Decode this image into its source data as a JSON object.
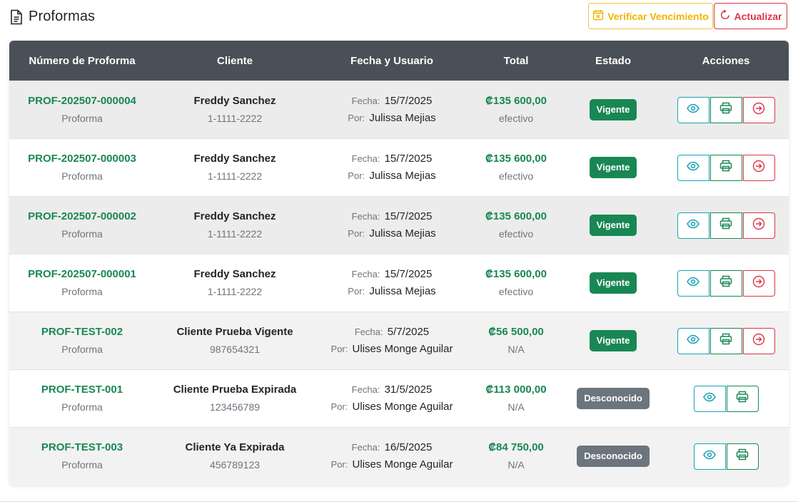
{
  "header": {
    "title": "Proformas",
    "verify_label": "Verificar Vencimiento",
    "refresh_label": "Actualizar"
  },
  "colors": {
    "header_bg": "#495057",
    "green": "#198754",
    "warning": "#f0b400",
    "danger": "#dc3545",
    "info": "#17a2b8",
    "muted": "#6c757d"
  },
  "icons": {
    "title": "document-icon",
    "verify": "calendar-x-icon",
    "refresh": "refresh-icon",
    "view": "eye-icon",
    "print": "printer-icon",
    "send": "arrow-right-circle-icon"
  },
  "table": {
    "columns": [
      "Número de Proforma",
      "Cliente",
      "Fecha y Usuario",
      "Total",
      "Estado",
      "Acciones"
    ],
    "fecha_label": "Fecha:",
    "por_label": "Por:",
    "rows": [
      {
        "number": "PROF-202507-000004",
        "type": "Proforma",
        "client": "Freddy Sanchez",
        "id": "1-1111-2222",
        "date": "15/7/2025",
        "user": "Julissa Mejias",
        "total": "₡135 600,00",
        "method": "efectivo",
        "status": "Vigente",
        "status_kind": "green",
        "has_send": true
      },
      {
        "number": "PROF-202507-000003",
        "type": "Proforma",
        "client": "Freddy Sanchez",
        "id": "1-1111-2222",
        "date": "15/7/2025",
        "user": "Julissa Mejias",
        "total": "₡135 600,00",
        "method": "efectivo",
        "status": "Vigente",
        "status_kind": "green",
        "has_send": true
      },
      {
        "number": "PROF-202507-000002",
        "type": "Proforma",
        "client": "Freddy Sanchez",
        "id": "1-1111-2222",
        "date": "15/7/2025",
        "user": "Julissa Mejias",
        "total": "₡135 600,00",
        "method": "efectivo",
        "status": "Vigente",
        "status_kind": "green",
        "has_send": true
      },
      {
        "number": "PROF-202507-000001",
        "type": "Proforma",
        "client": "Freddy Sanchez",
        "id": "1-1111-2222",
        "date": "15/7/2025",
        "user": "Julissa Mejias",
        "total": "₡135 600,00",
        "method": "efectivo",
        "status": "Vigente",
        "status_kind": "green",
        "has_send": true
      },
      {
        "number": "PROF-TEST-002",
        "type": "Proforma",
        "client": "Cliente Prueba Vigente",
        "id": "987654321",
        "date": "5/7/2025",
        "user": "Ulises Monge Aguilar",
        "total": "₡56 500,00",
        "method": "N/A",
        "status": "Vigente",
        "status_kind": "green",
        "has_send": true
      },
      {
        "number": "PROF-TEST-001",
        "type": "Proforma",
        "client": "Cliente Prueba Expirada",
        "id": "123456789",
        "date": "31/5/2025",
        "user": "Ulises Monge Aguilar",
        "total": "₡113 000,00",
        "method": "N/A",
        "status": "Desconocido",
        "status_kind": "gray",
        "has_send": false
      },
      {
        "number": "PROF-TEST-003",
        "type": "Proforma",
        "client": "Cliente Ya Expirada",
        "id": "456789123",
        "date": "16/5/2025",
        "user": "Ulises Monge Aguilar",
        "total": "₡84 750,00",
        "method": "N/A",
        "status": "Desconocido",
        "status_kind": "gray",
        "has_send": false
      }
    ]
  }
}
